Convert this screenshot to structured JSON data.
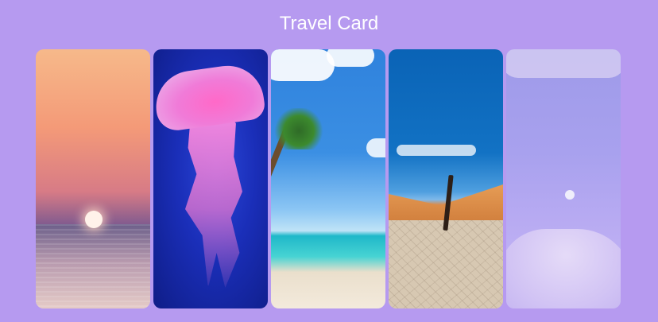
{
  "page": {
    "title": "Travel Card"
  },
  "cards": [
    {
      "name": "sunset-card",
      "scene": "sunset-over-sea"
    },
    {
      "name": "jellyfish-card",
      "scene": "pink-jellyfish"
    },
    {
      "name": "beach-card",
      "scene": "tropical-beach-palm"
    },
    {
      "name": "desert-card",
      "scene": "desert-dune-dead-tree"
    },
    {
      "name": "sky-card",
      "scene": "lavender-sky-moon"
    }
  ],
  "colors": {
    "background": "#b69af0",
    "title_text": "#ffffff"
  }
}
